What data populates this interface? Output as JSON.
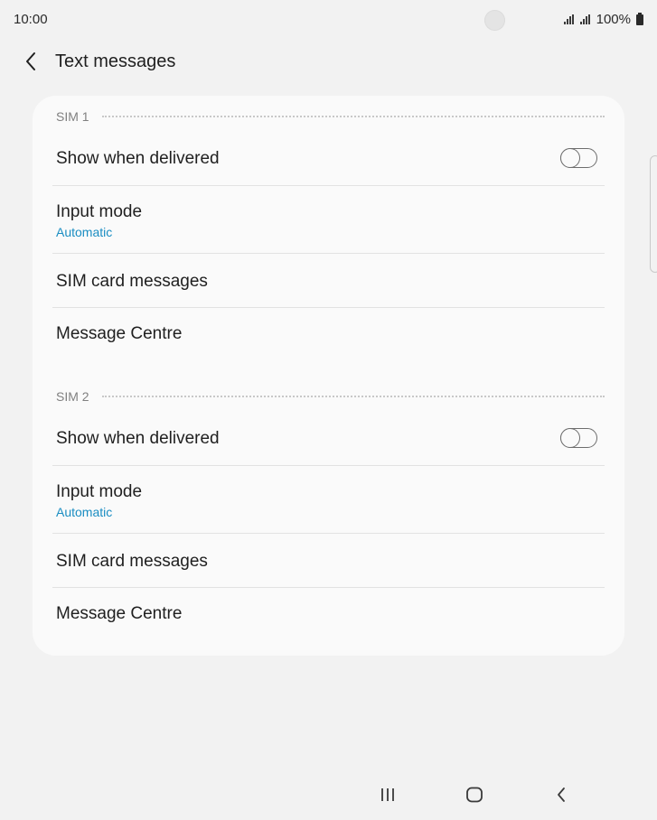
{
  "status_bar": {
    "time": "10:00",
    "battery": "100%"
  },
  "header": {
    "title": "Text messages"
  },
  "sections": [
    {
      "label": "SIM 1",
      "show_delivered": {
        "label": "Show when delivered",
        "on": false
      },
      "input_mode": {
        "label": "Input mode",
        "value": "Automatic"
      },
      "sim_card_messages": {
        "label": "SIM card messages"
      },
      "message_centre": {
        "label": "Message Centre"
      }
    },
    {
      "label": "SIM 2",
      "show_delivered": {
        "label": "Show when delivered",
        "on": false
      },
      "input_mode": {
        "label": "Input mode",
        "value": "Automatic"
      },
      "sim_card_messages": {
        "label": "SIM card messages"
      },
      "message_centre": {
        "label": "Message Centre"
      }
    }
  ],
  "colors": {
    "accent": "#1a8dc2",
    "background": "#f2f2f2",
    "card": "#fafafa"
  },
  "icons": {
    "back": "chevron-left-icon",
    "recents": "recent-apps-icon",
    "home": "home-icon",
    "nav_back": "back-icon"
  }
}
